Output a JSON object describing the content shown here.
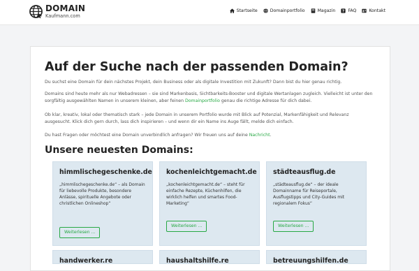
{
  "brand": {
    "name": "DOMAIN",
    "subname": "Kaufmann.com"
  },
  "nav": [
    {
      "label": "Startseite",
      "icon": "home-icon"
    },
    {
      "label": "Domainportfolio",
      "icon": "globe-icon"
    },
    {
      "label": "Magazin",
      "icon": "book-icon"
    },
    {
      "label": "FAQ",
      "icon": "help-icon"
    },
    {
      "label": "Kontakt",
      "icon": "contact-icon"
    }
  ],
  "main": {
    "title": "Auf der Suche nach der passenden Domain?",
    "p1": "Du suchst eine Domain für dein nächstes Projekt, dein Business oder als digitale Investition mit Zukunft? Dann bist du hier genau richtig.",
    "p2a": "Domains sind heute mehr als nur Webadressen – sie sind Markenbasis, Sichtbarkeits-Booster und digitale Wertanlagen zugleich. Vielleicht ist unter den sorgfältig ausgewählten Namen in unserem kleinen, aber feinen",
    "p2_link": "Domainportfolio",
    "p2b": "genau die richtige Adresse für dich dabei.",
    "p3": "Ob klar, kreativ, lokal oder thematisch stark – jede Domain in unserem Portfolio wurde mit Blick auf Potenzial, Markenfähigkeit und Relevanz ausgesucht. Klick dich gern durch, lass dich inspirieren – und wenn dir ein Name ins Auge fällt, melde dich einfach.",
    "p4a": "Du hast Fragen oder möchtest eine Domain unverbindlich anfragen? Wir freuen uns auf deine",
    "p4_link": "Nachricht",
    "p4b": ".",
    "subtitle": "Unsere neuesten Domains:"
  },
  "domains": [
    {
      "name": "himmlischegeschenke.de",
      "desc": "„himmlischegeschenke.de“ – als Domain für liebevolle Produkte, besondere Anlässe, spirituelle Angebote oder christlichen Onlineshop“",
      "button": "Weiterlesen ..."
    },
    {
      "name": "kochenleichtgemacht.de",
      "desc": "„kochenleichtgemacht.de“ – steht für einfache Rezepte, Küchenhilfen, die wirklich helfen und smartes Food-Marketing“",
      "button": "Weiterlesen ..."
    },
    {
      "name": "städteausflug.de",
      "desc": "„städteausflug.de“ – der ideale Domainname für Reiseportale, Ausflugstipps und City-Guides mit regionalem Fokus“",
      "button": "Weiterlesen ..."
    },
    {
      "name": "handwerker.re",
      "desc": "",
      "button": ""
    },
    {
      "name": "haushaltshilfe.re",
      "desc": "",
      "button": ""
    },
    {
      "name": "betreuungshilfen.de",
      "desc": "",
      "button": ""
    }
  ]
}
